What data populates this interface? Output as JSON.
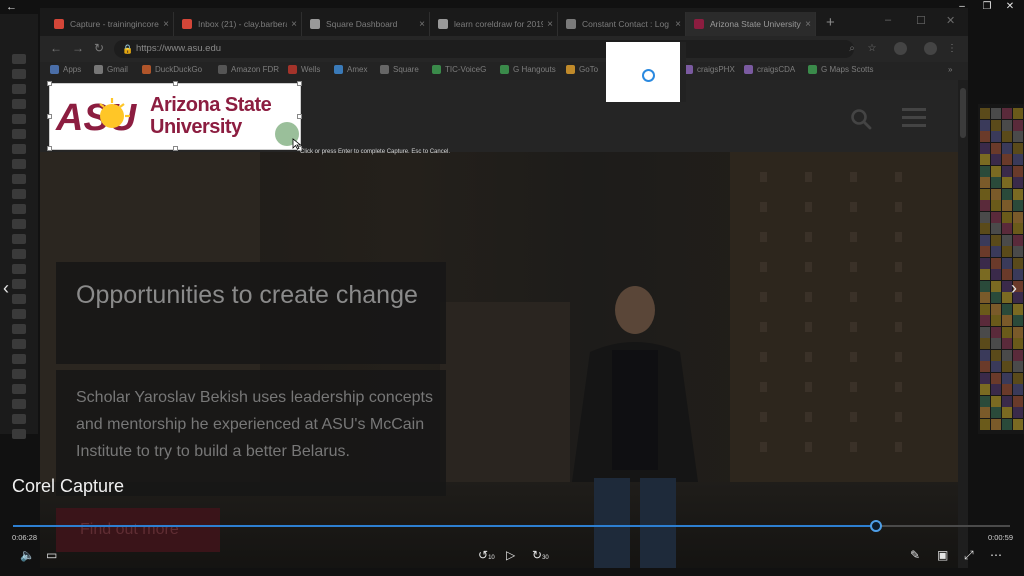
{
  "browser": {
    "tabs": [
      {
        "title": "Capture - trainingincorel",
        "favicon_color": "#d44638"
      },
      {
        "title": "Inbox (21) - clay.barbera",
        "favicon_color": "#d44638"
      },
      {
        "title": "Square Dashboard",
        "favicon_color": "#999999"
      },
      {
        "title": "learn coreldraw for 2019",
        "favicon_color": "#999999"
      },
      {
        "title": "Constant Contact : Log",
        "favicon_color": "#7a7a7a"
      },
      {
        "title": "Arizona State University",
        "favicon_color": "#8c1d40"
      }
    ],
    "url": "https://www.asu.edu",
    "bookmarks": [
      {
        "label": "Apps",
        "color": "#4a6ea8"
      },
      {
        "label": "Gmail",
        "color": "#777777"
      },
      {
        "label": "DuckDuckGo",
        "color": "#b0552a"
      },
      {
        "label": "Amazon FDR",
        "color": "#777777"
      },
      {
        "label": "Wells",
        "color": "#a3332a"
      },
      {
        "label": "Amex",
        "color": "#3a7ab8"
      },
      {
        "label": "Square",
        "color": "#777777"
      },
      {
        "label": "TIC-VoiceG",
        "color": "#3a8a4a"
      },
      {
        "label": "G Hangouts",
        "color": "#3a8a4a"
      },
      {
        "label": "GoTo",
        "color": "#c08a2a"
      },
      {
        "label": "craigsPHX",
        "color": "#7a5aa0"
      },
      {
        "label": "craigsCDA",
        "color": "#7a5aa0"
      },
      {
        "label": "G Maps Scotts",
        "color": "#3a8a4a"
      }
    ]
  },
  "asu": {
    "logo_letters": "ASU",
    "name_line1": "Arizona State",
    "name_line2": "University",
    "brand_color": "#8c1d40",
    "hero": {
      "title": "Opportunities to create change",
      "body": "Scholar Yaroslav Bekish uses leadership concepts and mentorship he experienced at ASU's McCain Institute to try to build a better Belarus.",
      "cta": "Find out more"
    }
  },
  "capture": {
    "hint": "Click or press Enter to complete Capture. Esc to Cancel."
  },
  "player": {
    "video_title": "Corel Capture",
    "time_elapsed": "0:06:28",
    "time_remaining": "0:00:59",
    "progress_fraction": 0.866,
    "accent_color": "#2d7fd1",
    "controls": {
      "back_label": "10",
      "forward_label": "30"
    }
  }
}
